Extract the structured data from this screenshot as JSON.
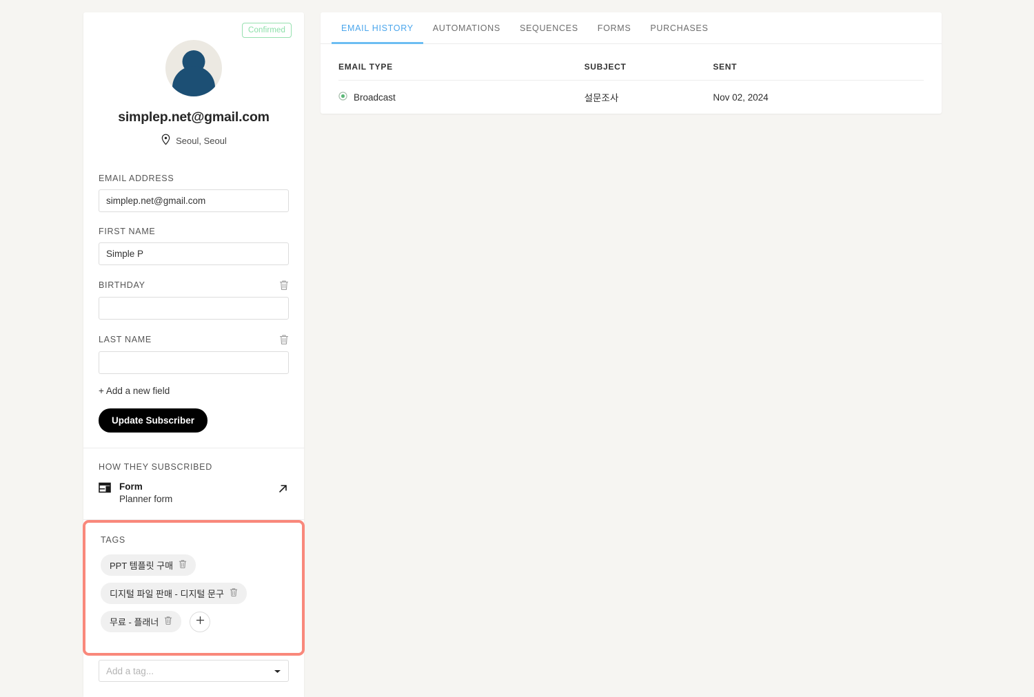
{
  "profile": {
    "status_badge": "Confirmed",
    "email": "simplep.net@gmail.com",
    "location": "Seoul, Seoul",
    "avatar_icon": "user-avatar-icon",
    "location_icon": "map-pin-icon"
  },
  "form": {
    "fields": [
      {
        "label": "EMAIL ADDRESS",
        "value": "simplep.net@gmail.com",
        "placeholder": "",
        "deletable": false
      },
      {
        "label": "FIRST NAME",
        "value": "Simple P",
        "placeholder": "",
        "deletable": false
      },
      {
        "label": "BIRTHDAY",
        "value": "",
        "placeholder": "",
        "deletable": true
      },
      {
        "label": "LAST NAME",
        "value": "",
        "placeholder": "",
        "deletable": true
      }
    ],
    "add_field_label": "+ Add a new field",
    "update_button": "Update Subscriber",
    "delete_icon": "trash-icon"
  },
  "subscribed": {
    "title": "HOW THEY SUBSCRIBED",
    "type": "Form",
    "name": "Planner form",
    "form_icon": "form-layout-icon",
    "external_link_icon": "arrow-up-right-icon"
  },
  "tags": {
    "title": "TAGS",
    "items": [
      {
        "label": "PPT 템플릿 구매"
      },
      {
        "label": "디지털 파일 판매 - 디지털 문구"
      },
      {
        "label": "무료 - 플래너"
      }
    ],
    "add_tag_icon": "plus-icon",
    "select_placeholder": "Add a tag...",
    "highlight_color": "#f9887b"
  },
  "right_panel": {
    "tabs": [
      {
        "label": "EMAIL HISTORY",
        "active": true
      },
      {
        "label": "AUTOMATIONS",
        "active": false
      },
      {
        "label": "SEQUENCES",
        "active": false
      },
      {
        "label": "FORMS",
        "active": false
      },
      {
        "label": "PURCHASES",
        "active": false
      }
    ],
    "table": {
      "headers": [
        "EMAIL TYPE",
        "SUBJECT",
        "SENT"
      ],
      "rows": [
        {
          "type": "Broadcast",
          "subject": "설문조사",
          "sent": "Nov 02, 2024",
          "status_icon": "radio-circle-icon"
        }
      ]
    }
  }
}
